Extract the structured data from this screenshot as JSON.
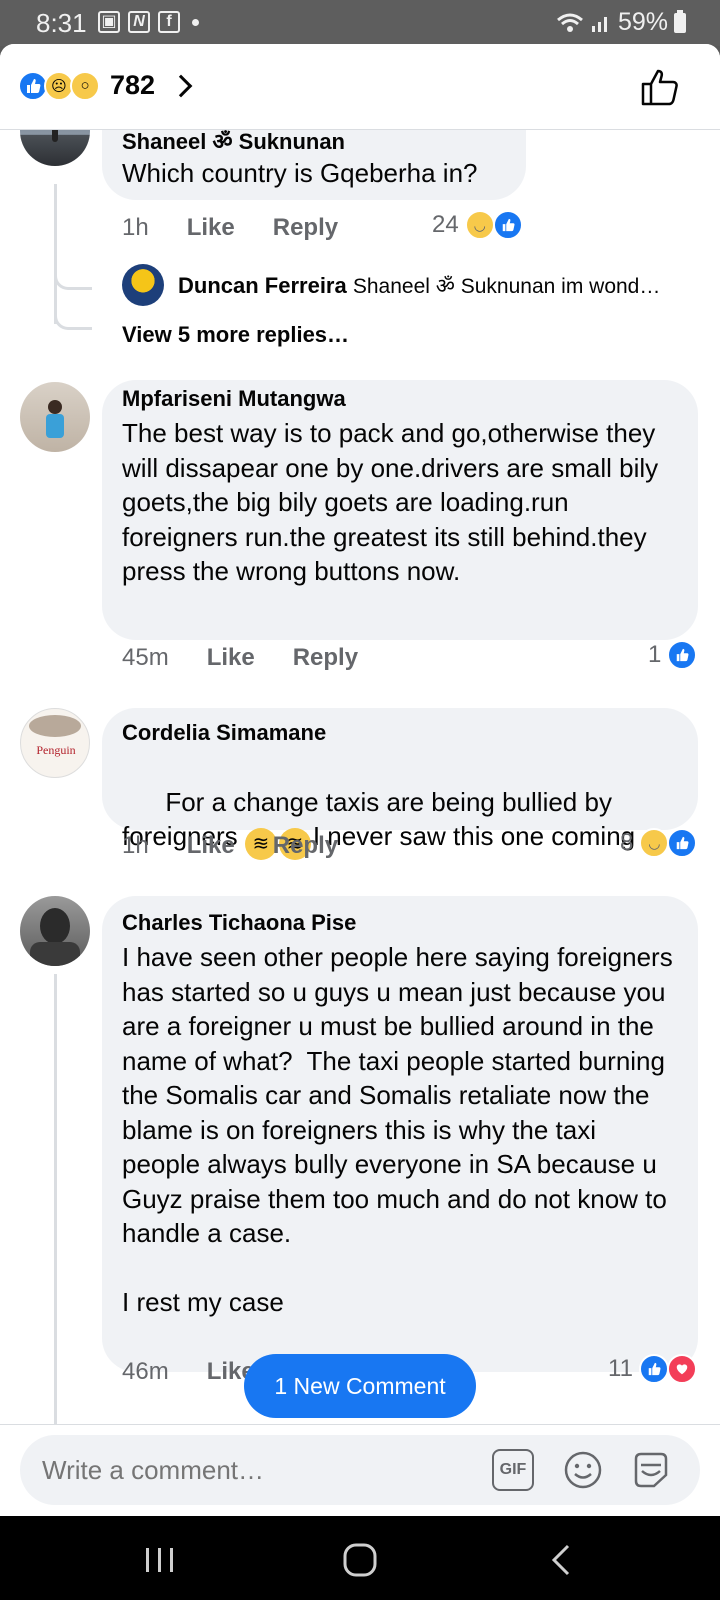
{
  "status_bar": {
    "time": "8:31",
    "battery": "59%",
    "notif_icons": [
      "gallery-icon",
      "n-app-icon",
      "facebook-icon"
    ]
  },
  "header": {
    "reaction_count": "782",
    "reactions": [
      "like",
      "sad",
      "wow"
    ]
  },
  "comments": [
    {
      "author": "Shaneel ॐ Suknunan",
      "text": "Which country is Gqeberha in?",
      "time": "1h",
      "like": "Like",
      "reply": "Reply",
      "reaction_count": "24",
      "reactions": [
        "haha",
        "like"
      ],
      "reply_preview": {
        "author": "Duncan Ferreira",
        "text": "Shaneel ॐ Suknunan im wond…"
      },
      "view_more": "View 5 more replies…"
    },
    {
      "author": "Mpfariseni Mutangwa",
      "text": "The best way is to pack and go,otherwise they will dissapear one by one.drivers are small bily goets,the big bily goets are loading.run foreigners run.the greatest its still behind.they press the wrong buttons now.",
      "time": "45m",
      "like": "Like",
      "reply": "Reply",
      "reaction_count": "1",
      "reactions": [
        "like"
      ]
    },
    {
      "author": "Cordelia Simamane",
      "text_a": "For a change taxis are being bullied by foreigners ",
      "text_b": "I never saw this one coming",
      "avatar_text": "Penguin",
      "time": "1h",
      "like": "Like",
      "reply": "Reply",
      "reaction_count": "8",
      "reactions": [
        "haha",
        "like"
      ]
    },
    {
      "author": "Charles Tichaona Pise",
      "text": "I have seen other people here saying foreigners has started so u guys u mean just because you are a foreigner u must be bullied around in the name of what?  The taxi people started burning the Somalis car and Somalis retaliate now the blame is on foreigners this is why the taxi people always bully everyone in SA because u Guyz praise them too much and do not know to handle a case.\n\nI rest my case",
      "time": "46m",
      "like": "Like",
      "reaction_count": "11",
      "reactions": [
        "like",
        "love"
      ]
    }
  ],
  "new_comment_pill": "1 New Comment",
  "composer": {
    "placeholder": "Write a comment…",
    "gif_label": "GIF"
  },
  "colors": {
    "accent": "#1877f2",
    "bubble": "#f0f2f5",
    "secondary_text": "#65676b"
  }
}
